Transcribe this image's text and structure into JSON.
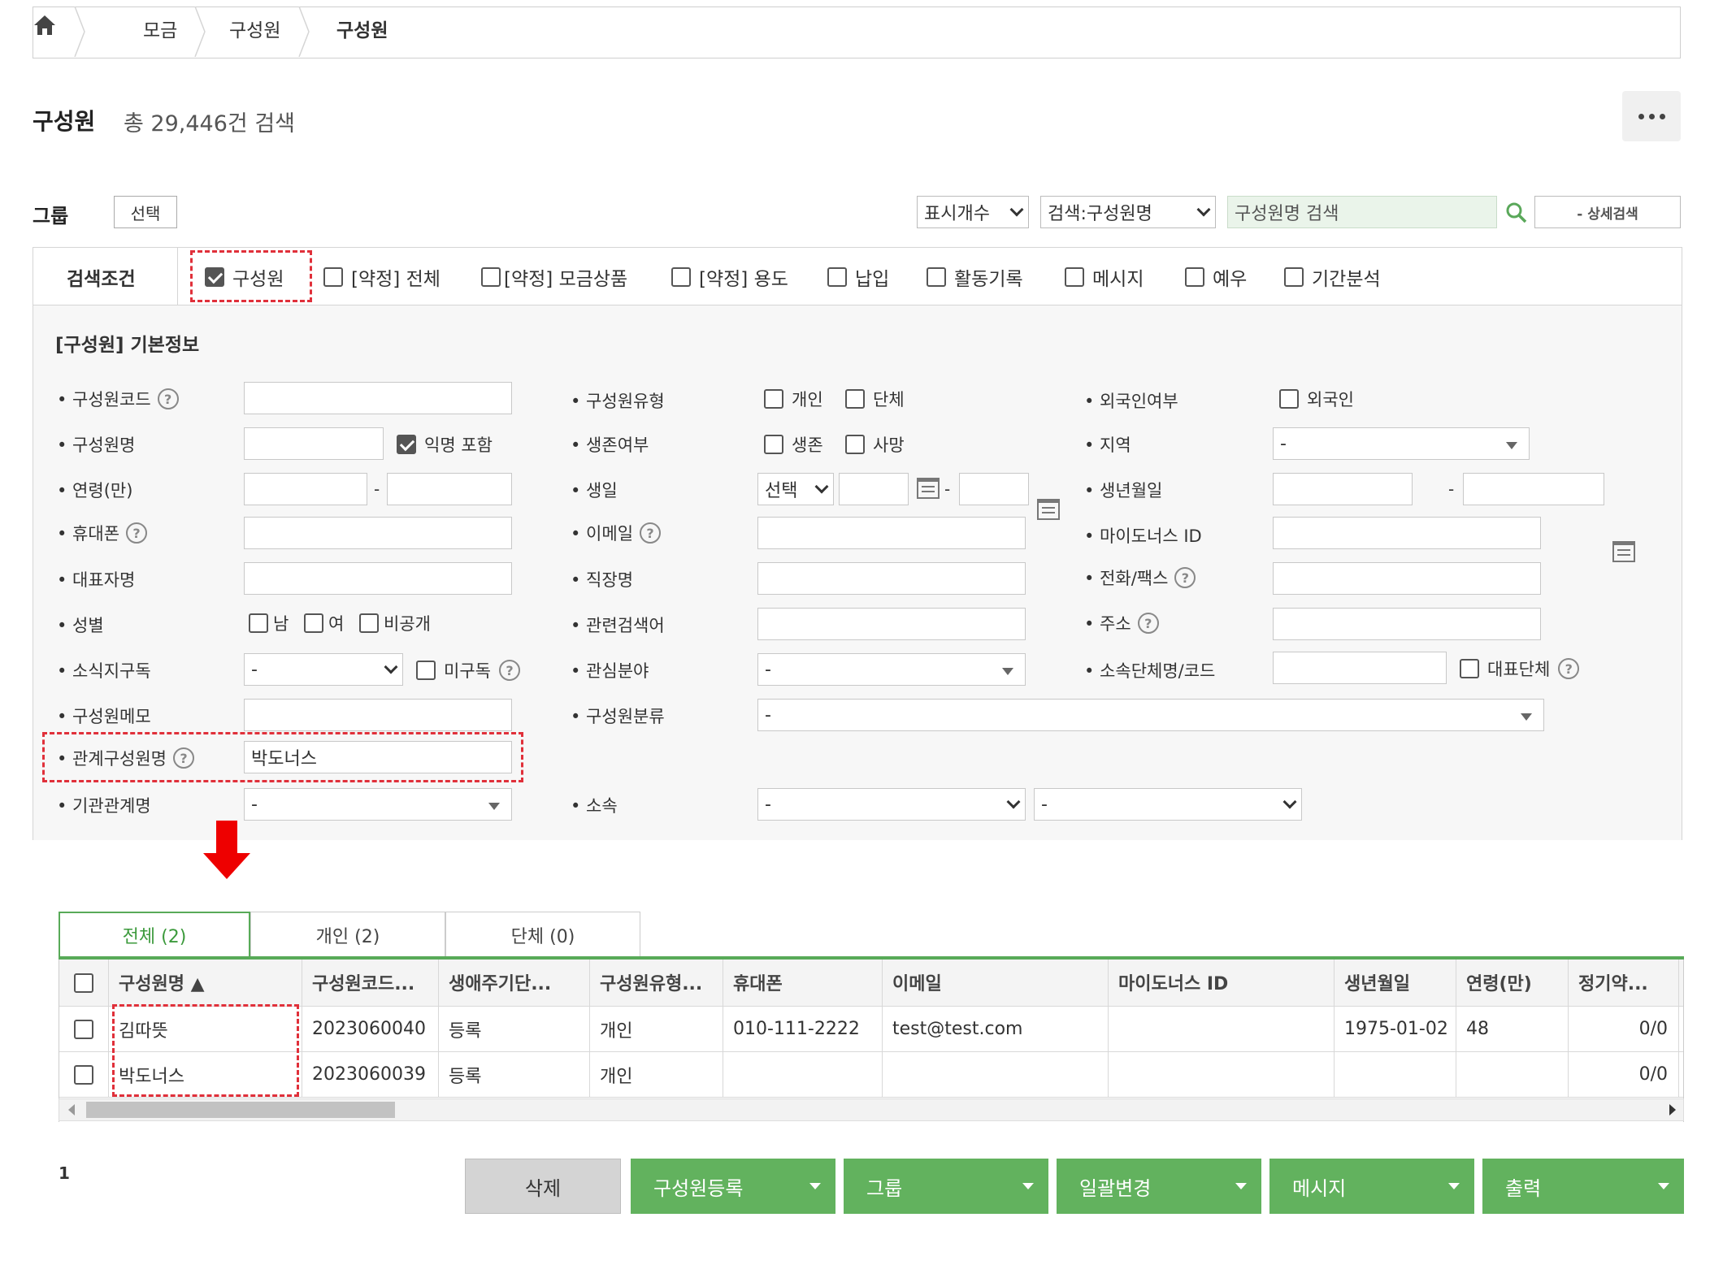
{
  "breadcrumb": {
    "items": [
      "모금",
      "구성원",
      "구성원"
    ]
  },
  "header": {
    "title": "구성원",
    "count_text": "총 29,446건 검색"
  },
  "toolbar": {
    "group_label": "그룹",
    "group_select_button": "선택",
    "display_count_select": "표시개수",
    "search_field_select": "검색:구성원명",
    "search_placeholder": "구성원명 검색",
    "detail_search_button": "- 상세검색"
  },
  "conditions": {
    "label": "검색조건",
    "items": [
      {
        "label": "구성원",
        "checked": true
      },
      {
        "label": "[약정] 전체",
        "checked": false
      },
      {
        "label": "[약정] 모금상품",
        "checked": false
      },
      {
        "label": "[약정] 용도",
        "checked": false
      },
      {
        "label": "납입",
        "checked": false
      },
      {
        "label": "활동기록",
        "checked": false
      },
      {
        "label": "메시지",
        "checked": false
      },
      {
        "label": "예우",
        "checked": false
      },
      {
        "label": "기간분석",
        "checked": false
      }
    ]
  },
  "form": {
    "section_title": "[구성원] 기본정보",
    "labels": {
      "member_code": "• 구성원코드",
      "member_name": "• 구성원명",
      "age": "• 연령(만)",
      "mobile": "• 휴대폰",
      "rep_name": "• 대표자명",
      "gender": "• 성별",
      "newsletter": "• 소식지구독",
      "memo": "• 구성원메모",
      "relation_name": "• 관계구성원명",
      "org_relation": "• 기관관계명",
      "member_type": "• 구성원유형",
      "alive": "• 생존여부",
      "birthday": "• 생일",
      "email": "• 이메일",
      "workplace": "• 직장명",
      "keyword": "• 관련검색어",
      "interest": "• 관심분야",
      "classification": "• 구성원분류",
      "affiliation": "• 소속",
      "foreigner": "• 외국인여부",
      "region": "• 지역",
      "birthdate": "• 생년월일",
      "mydonors_id": "• 마이도너스 ID",
      "tel_fax": "• 전화/팩스",
      "address": "• 주소",
      "group_name": "• 소속단체명/코드"
    },
    "options": {
      "anonymous": "익명 포함",
      "individual": "개인",
      "group": "단체",
      "foreigner": "외국인",
      "alive": "생존",
      "dead": "사망",
      "male": "남",
      "female": "여",
      "private": "비공개",
      "unsubscribed": "미구독",
      "rep_group": "대표단체"
    },
    "values": {
      "relation_name": "박도너스",
      "birthday_select": "선택",
      "dash": "-",
      "tilde": "-"
    },
    "checks": {
      "anonymous": true
    }
  },
  "tabs": [
    {
      "label": "전체 (2)",
      "active": true
    },
    {
      "label": "개인 (2)",
      "active": false
    },
    {
      "label": "단체 (0)",
      "active": false
    }
  ],
  "table": {
    "columns": [
      "구성원명 ▲",
      "구성원코드...",
      "생애주기단...",
      "구성원유형...",
      "휴대폰",
      "이메일",
      "마이도너스 ID",
      "생년월일",
      "연령(만)",
      "정기약..."
    ],
    "rows": [
      [
        "김따뜻",
        "2023060040",
        "등록",
        "개인",
        "010-111-2222",
        "test@test.com",
        "",
        "1975-01-02",
        "48",
        "0/0"
      ],
      [
        "박도너스",
        "2023060039",
        "등록",
        "개인",
        "",
        "",
        "",
        "",
        "",
        "0/0"
      ]
    ]
  },
  "pagination": {
    "current": "1"
  },
  "actions": {
    "delete": "삭제",
    "register": "구성원등록",
    "group": "그룹",
    "bulk_change": "일괄변경",
    "message": "메시지",
    "print": "출력"
  },
  "colors": {
    "accent_green": "#62b25e",
    "highlight_red": "#e0303a"
  }
}
